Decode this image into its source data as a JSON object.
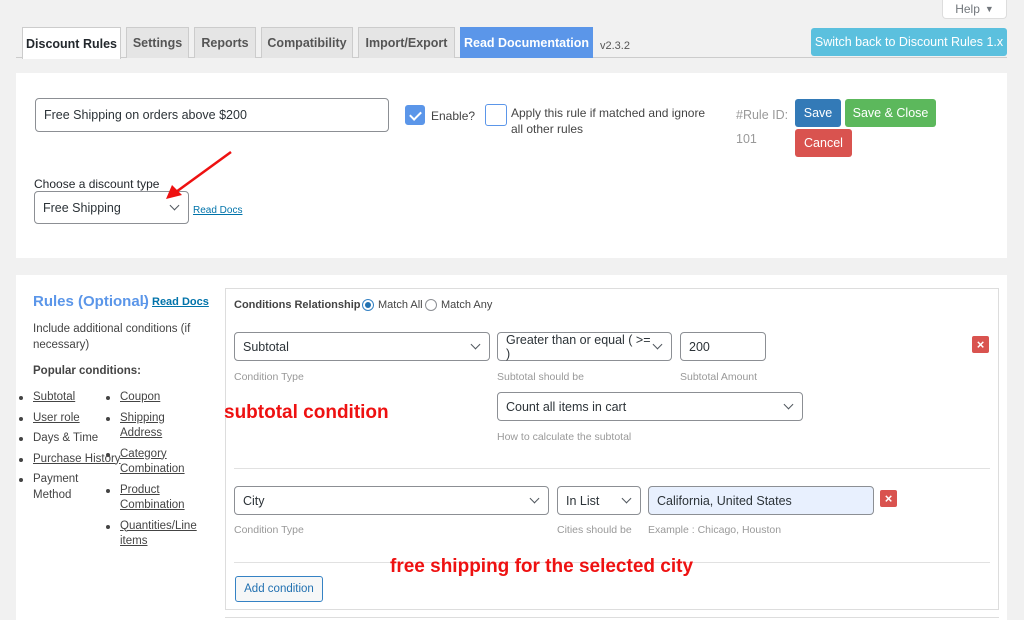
{
  "header": {
    "help_label": "Help",
    "help_icon": "triangle-down-icon",
    "tabs": [
      {
        "label": "Discount Rules",
        "active": true
      },
      {
        "label": "Settings",
        "active": false
      },
      {
        "label": "Reports",
        "active": false
      },
      {
        "label": "Compatibility",
        "active": false
      },
      {
        "label": "Import/Export",
        "active": false
      },
      {
        "label": "Read Documentation",
        "active": false
      }
    ],
    "version": "v2.3.2",
    "switch_back_label": "Switch back to Discount Rules 1.x"
  },
  "rule": {
    "title_value": "Free Shipping on orders above $200",
    "enable_label": "Enable?",
    "enable_checked": true,
    "apply_label": "Apply this rule if matched and ignore all other rules",
    "apply_checked": false,
    "rule_id_label": "#Rule ID:",
    "rule_id_value": "101",
    "save_label": "Save",
    "save_close_label": "Save & Close",
    "cancel_label": "Cancel",
    "discount_type_label": "Choose a discount type",
    "discount_type_value": "Free Shipping",
    "read_docs_label": "Read Docs"
  },
  "rules_sidebar": {
    "title": "Rules (Optional)",
    "dash": "-",
    "read_docs_label": "Read Docs",
    "description": "Include additional conditions (if necessary)",
    "popular_label": "Popular conditions:",
    "left_items": [
      {
        "label": "Subtotal",
        "link": true
      },
      {
        "label": "User role",
        "link": true
      },
      {
        "label": "Days & Time",
        "link": false
      },
      {
        "label": "Purchase History",
        "link": true
      },
      {
        "label": "Payment Method",
        "link": false
      }
    ],
    "right_items": [
      {
        "label": "Coupon",
        "link": true
      },
      {
        "label": "Shipping Address",
        "link": true
      },
      {
        "label": "Category Combination",
        "link": true
      },
      {
        "label": "Product Combination",
        "link": true
      },
      {
        "label": "Quantities/Line items",
        "link": true
      }
    ]
  },
  "conditions": {
    "relationship_label": "Conditions Relationship",
    "match_all_label": "Match All",
    "match_any_label": "Match Any",
    "selected": "Match All",
    "subtotal": {
      "type_value": "Subtotal",
      "type_hint": "Condition Type",
      "operator_value": "Greater than or equal ( >= )",
      "operator_hint": "Subtotal should be",
      "amount_value": "200",
      "amount_hint": "Subtotal Amount",
      "calc_value": "Count all items in cart",
      "calc_hint": "How to calculate the subtotal"
    },
    "city": {
      "type_value": "City",
      "type_hint": "Condition Type",
      "operator_value": "In List",
      "operator_hint": "Cities should be",
      "cities_value": "California, United States",
      "cities_hint": "Example : Chicago, Houston"
    },
    "add_condition_label": "Add condition",
    "delete_icon": "×"
  },
  "annotations": {
    "subtotal_note": "subtotal condition",
    "city_note": "free shipping for the selected city",
    "color": "#ee1111"
  }
}
